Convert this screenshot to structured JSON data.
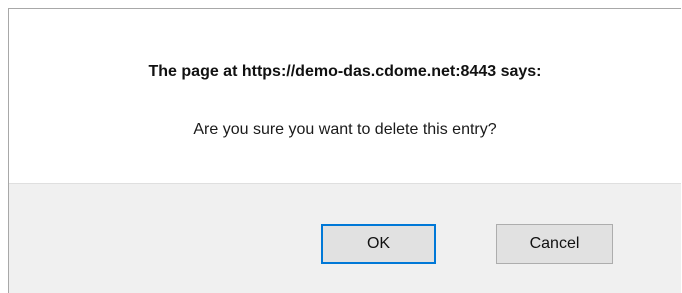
{
  "dialog": {
    "title": "The page at https://demo-das.cdome.net:8443 says:",
    "message": "Are you sure you want to delete this entry?",
    "ok_label": "OK",
    "cancel_label": "Cancel"
  },
  "colors": {
    "footer_background": "#f0f0f0",
    "button_background": "#e1e1e1",
    "focus_border": "#0078d7"
  }
}
